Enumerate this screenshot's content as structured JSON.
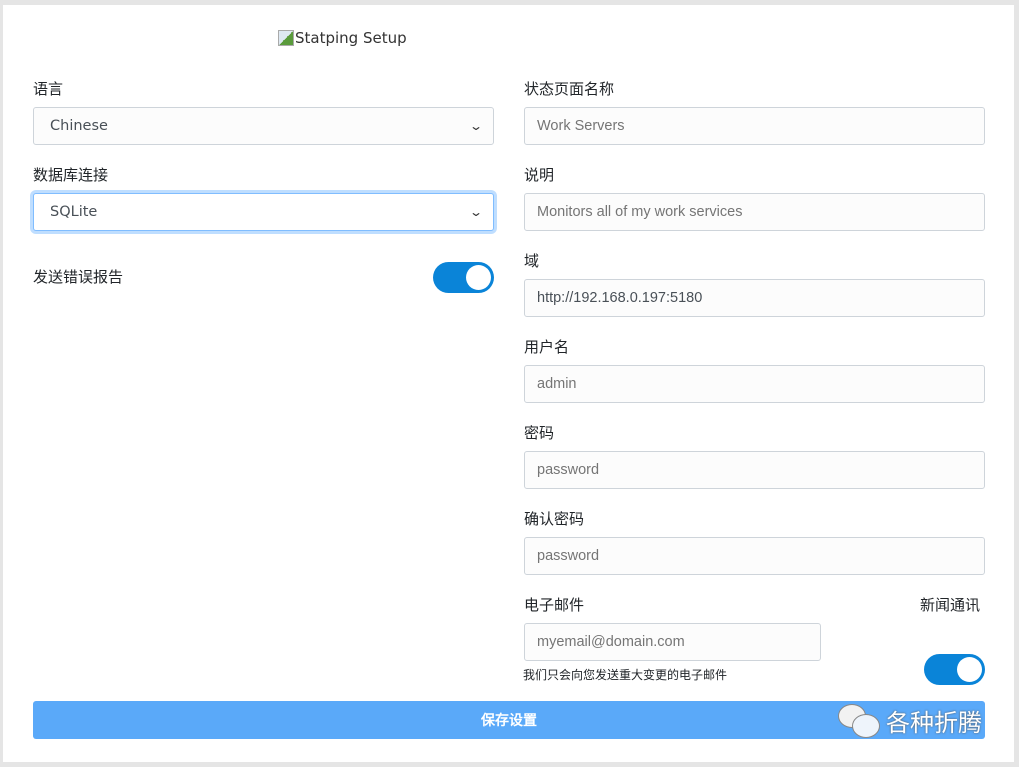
{
  "header": {
    "logo_alt": "Statping Setup"
  },
  "left": {
    "language": {
      "label": "语言",
      "value": "Chinese"
    },
    "database": {
      "label": "数据库连接",
      "value": "SQLite"
    },
    "error_reports": {
      "label": "发送错误报告",
      "on": true
    }
  },
  "right": {
    "project": {
      "label": "状态页面名称",
      "placeholder": "Work Servers"
    },
    "description": {
      "label": "说明",
      "placeholder": "Monitors all of my work services"
    },
    "domain": {
      "label": "域",
      "value": "http://192.168.0.197:5180"
    },
    "username": {
      "label": "用户名",
      "placeholder": "admin"
    },
    "password": {
      "label": "密码",
      "placeholder": "password"
    },
    "confirm": {
      "label": "确认密码",
      "placeholder": "password"
    },
    "email": {
      "label": "电子邮件",
      "placeholder": "myemail@domain.com",
      "help": "我们只会向您发送重大变更的电子邮件"
    },
    "newsletter": {
      "label": "新闻通讯",
      "on": true
    }
  },
  "save_label": "保存设置",
  "watermark": "各种折腾",
  "colors": {
    "toggle": "#0a84d8",
    "button": "#5aa9f9"
  }
}
